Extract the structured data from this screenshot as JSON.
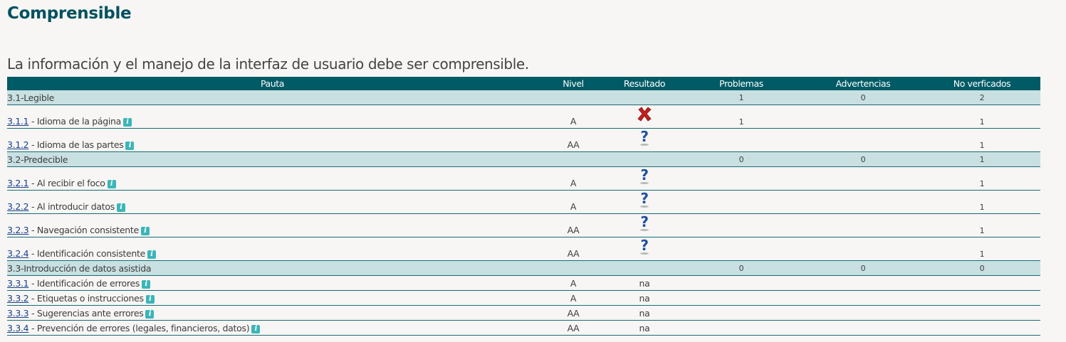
{
  "page": {
    "title": "Comprensible",
    "subtitle": "La información y el manejo de la interfaz de usuario debe ser comprensible."
  },
  "table": {
    "headers": {
      "pauta": "Pauta",
      "nivel": "Nivel",
      "resultado": "Resultado",
      "problemas": "Problemas",
      "advertencias": "Advertencias",
      "no_verificados": "No verficados"
    },
    "rows": [
      {
        "type": "group",
        "label": "3.1-Legible",
        "problemas": "1",
        "advertencias": "0",
        "no_verificados": "2"
      },
      {
        "type": "criterion",
        "code": "3.1.1",
        "name": " - Idioma de la página",
        "nivel": "A",
        "resultado": "fail",
        "problemas": "1",
        "advertencias": "",
        "no_verificados": "1"
      },
      {
        "type": "criterion",
        "code": "3.1.2",
        "name": " - Idioma de las partes",
        "nivel": "AA",
        "resultado": "unverified",
        "problemas": "",
        "advertencias": "",
        "no_verificados": "1"
      },
      {
        "type": "group",
        "label": "3.2-Predecible",
        "problemas": "0",
        "advertencias": "0",
        "no_verificados": "1"
      },
      {
        "type": "criterion",
        "code": "3.2.1",
        "name": " - Al recibir el foco",
        "nivel": "A",
        "resultado": "unverified",
        "problemas": "",
        "advertencias": "",
        "no_verificados": "1"
      },
      {
        "type": "criterion",
        "code": "3.2.2",
        "name": " - Al introducir datos",
        "nivel": "A",
        "resultado": "unverified",
        "problemas": "",
        "advertencias": "",
        "no_verificados": "1"
      },
      {
        "type": "criterion",
        "code": "3.2.3",
        "name": " - Navegación consistente",
        "nivel": "AA",
        "resultado": "unverified",
        "problemas": "",
        "advertencias": "",
        "no_verificados": "1"
      },
      {
        "type": "criterion",
        "code": "3.2.4",
        "name": " - Identificación consistente",
        "nivel": "AA",
        "resultado": "unverified",
        "problemas": "",
        "advertencias": "",
        "no_verificados": "1"
      },
      {
        "type": "group",
        "label": "3.3-Introducción de datos asistida",
        "problemas": "0",
        "advertencias": "0",
        "no_verificados": "0"
      },
      {
        "type": "criterion",
        "code": "3.3.1",
        "name": " - Identificación de errores",
        "nivel": "A",
        "resultado": "na",
        "problemas": "",
        "advertencias": "",
        "no_verificados": ""
      },
      {
        "type": "criterion",
        "code": "3.3.2",
        "name": " - Etiquetas o instrucciones",
        "nivel": "A",
        "resultado": "na",
        "problemas": "",
        "advertencias": "",
        "no_verificados": ""
      },
      {
        "type": "criterion",
        "code": "3.3.3",
        "name": " - Sugerencias ante errores",
        "nivel": "AA",
        "resultado": "na",
        "problemas": "",
        "advertencias": "",
        "no_verificados": ""
      },
      {
        "type": "criterion",
        "code": "3.3.4",
        "name": " - Prevención de errores (legales, financieros, datos)",
        "nivel": "AA",
        "resultado": "na",
        "problemas": "",
        "advertencias": "",
        "no_verificados": ""
      }
    ]
  },
  "icons": {
    "info": "info-icon",
    "fail": "red-x-icon",
    "unverified": "question-mark-icon"
  },
  "colors": {
    "title": "#00515e",
    "header_bg": "#005b66",
    "group_bg": "#c9e0e2",
    "info_icon": "#3bb5b9",
    "fail": "#c0201e",
    "question": "#1f4fa0"
  }
}
